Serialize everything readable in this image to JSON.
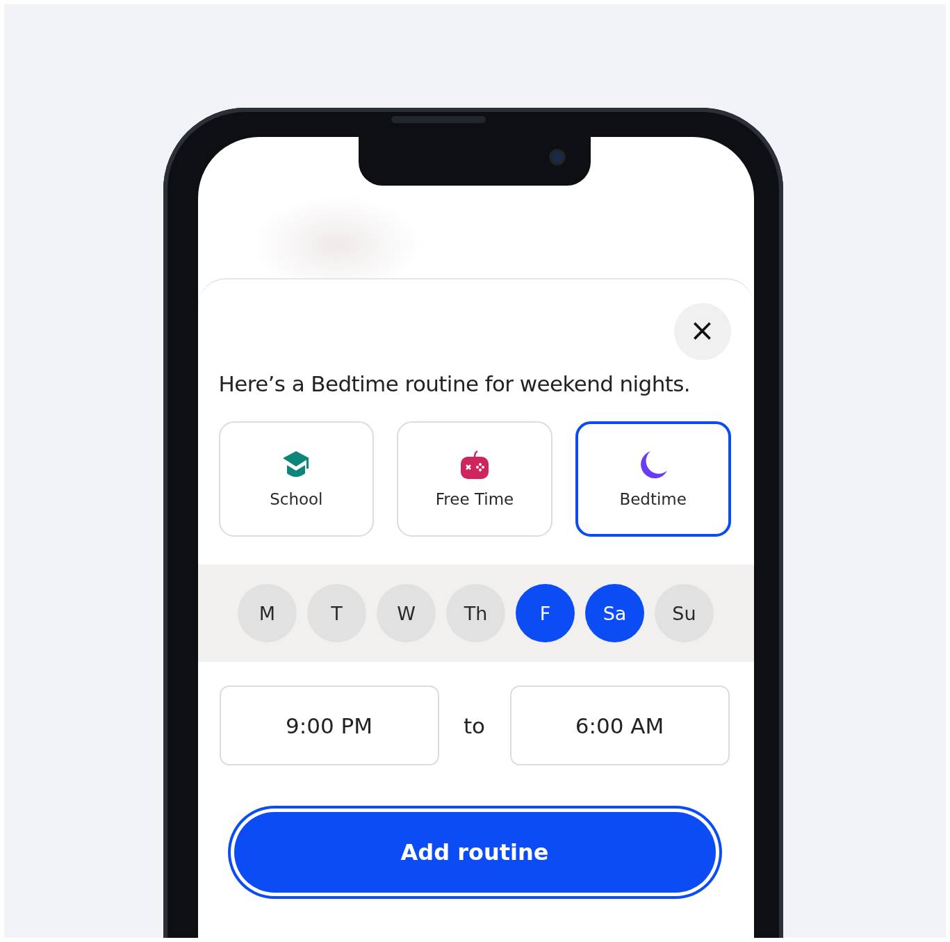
{
  "sheet": {
    "close_label": "×",
    "message": "Here’s a Bedtime routine for weekend nights.",
    "routines": [
      {
        "label": "School",
        "kind": "school",
        "selected": false
      },
      {
        "label": "Free Time",
        "kind": "game",
        "selected": false
      },
      {
        "label": "Bedtime",
        "kind": "moon",
        "selected": true
      }
    ],
    "days": [
      {
        "label": "M",
        "selected": false
      },
      {
        "label": "T",
        "selected": false
      },
      {
        "label": "W",
        "selected": false
      },
      {
        "label": "Th",
        "selected": false
      },
      {
        "label": "F",
        "selected": true
      },
      {
        "label": "Sa",
        "selected": true
      },
      {
        "label": "Su",
        "selected": false
      }
    ],
    "time_from": "9:00 PM",
    "time_separator": "to",
    "time_to": "6:00 AM",
    "submit": "Add routine"
  }
}
